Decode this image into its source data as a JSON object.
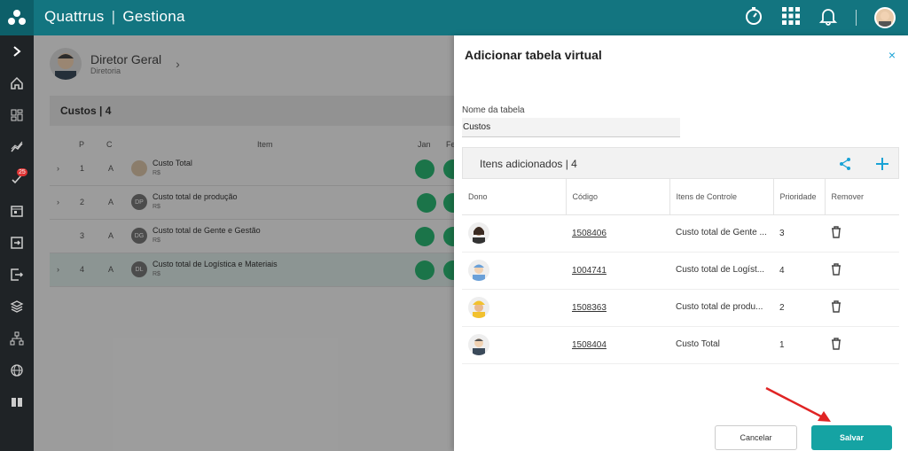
{
  "app": {
    "brand_left": "Quattrus",
    "brand_separator": "|",
    "brand_right": "Gestiona",
    "accent_color": "#137580"
  },
  "topbar_icons": [
    "stopwatch-icon",
    "apps-grid-icon",
    "bell-icon"
  ],
  "sidebar": {
    "items": [
      {
        "icon": "expand-chevron-icon"
      },
      {
        "icon": "home-icon"
      },
      {
        "icon": "dashboard-icon"
      },
      {
        "icon": "trend-icon"
      },
      {
        "icon": "tasks-icon",
        "badge": "25"
      },
      {
        "icon": "calendar-icon"
      },
      {
        "icon": "login-icon"
      },
      {
        "icon": "logout-icon"
      },
      {
        "icon": "layers-icon"
      },
      {
        "icon": "hierarchy-icon"
      },
      {
        "icon": "globe-icon"
      },
      {
        "icon": "book-icon"
      }
    ]
  },
  "profile": {
    "name": "Diretor Geral",
    "subtitle": "Diretoria"
  },
  "section": {
    "title": "Custos | 4"
  },
  "background_grid": {
    "headers": {
      "p": "P",
      "c": "C",
      "item": "Item",
      "jan": "Jan",
      "fev": "Fe"
    },
    "rows": [
      {
        "p": "1",
        "c": "A",
        "initials": "",
        "title": "Custo Total",
        "unit": "R$"
      },
      {
        "p": "2",
        "c": "A",
        "initials": "DP",
        "title": "Custo total de produção",
        "unit": "R$"
      },
      {
        "p": "3",
        "c": "A",
        "initials": "DG",
        "title": "Custo total de Gente e Gestão",
        "unit": "R$"
      },
      {
        "p": "4",
        "c": "A",
        "initials": "DL",
        "title": "Custo total de Logística e Materiais",
        "unit": "R$"
      }
    ]
  },
  "modal": {
    "title": "Adicionar tabela virtual",
    "close_icon": "×",
    "field_label": "Nome da tabela",
    "field_value": "Custos",
    "items_title": "Itens adicionados | 4",
    "columns": [
      "Dono",
      "Código",
      "Itens de Controle",
      "Prioridade",
      "Remover"
    ],
    "rows": [
      {
        "code": "1508406",
        "item": "Custo total de Gente ...",
        "priority": "3"
      },
      {
        "code": "1004741",
        "item": "Custo total de Logíst...",
        "priority": "4"
      },
      {
        "code": "1508363",
        "item": "Custo total de produ...",
        "priority": "2"
      },
      {
        "code": "1508404",
        "item": "Custo Total",
        "priority": "1"
      }
    ],
    "cancel_label": "Cancelar",
    "save_label": "Salvar",
    "save_color": "#15a3a3"
  }
}
